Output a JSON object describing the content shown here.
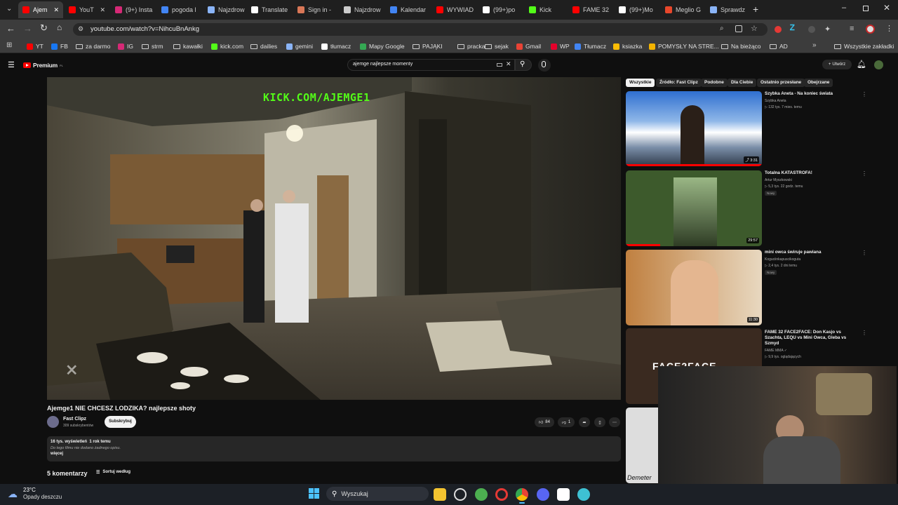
{
  "browser": {
    "tabs": [
      {
        "label": "Ajem",
        "color": "#ff0000",
        "active": true
      },
      {
        "label": "YouT",
        "color": "#ff0000"
      },
      {
        "label": "(9+) Insta",
        "color": "#d62976"
      },
      {
        "label": "pogoda l",
        "color": "#4285f4"
      },
      {
        "label": "Najzdrow",
        "color": "#8ab4f8"
      },
      {
        "label": "Translate",
        "color": "#ffffff"
      },
      {
        "label": "Sign in -",
        "color": "#d97757"
      },
      {
        "label": "Najzdrow",
        "color": "#cccccc"
      },
      {
        "label": "Kalendar",
        "color": "#4285f4"
      },
      {
        "label": "WYWIAD",
        "color": "#ff0000"
      },
      {
        "label": "(99+)po",
        "color": "#ffffff"
      },
      {
        "label": "Kick",
        "color": "#53fc18"
      },
      {
        "label": "FAME 32",
        "color": "#ff0000"
      },
      {
        "label": "(99+)Mo",
        "color": "#ffffff"
      },
      {
        "label": "Meglio G",
        "color": "#e8472b"
      },
      {
        "label": "Sprawdz",
        "color": "#8ab4f8"
      }
    ],
    "new_tab_label": "+",
    "url": "youtube.com/watch?v=NihcuBnAnkg",
    "bookmarks": [
      {
        "label": "YT",
        "color": "#ff0000"
      },
      {
        "label": "FB",
        "color": "#1877f2"
      },
      {
        "label": "za darmo",
        "color": "folder"
      },
      {
        "label": "IG",
        "color": "#d62976"
      },
      {
        "label": "strm",
        "color": "folder"
      },
      {
        "label": "kawałki",
        "color": "folder"
      },
      {
        "label": "kick.com",
        "color": "#53fc18"
      },
      {
        "label": "dailies",
        "color": "folder"
      },
      {
        "label": "gemini",
        "color": "#8ab4f8"
      },
      {
        "label": "tłumacz",
        "color": "#ffffff"
      },
      {
        "label": "Mapy Google",
        "color": "#34a853"
      },
      {
        "label": "PAJĄKI",
        "color": "folder"
      },
      {
        "label": "pracka",
        "color": "folder"
      },
      {
        "label": "sejak",
        "color": "folder"
      },
      {
        "label": "Gmail",
        "color": "#ea4335"
      },
      {
        "label": "WP",
        "color": "#e4002b"
      },
      {
        "label": "Tłumacz",
        "color": "#4285f4"
      },
      {
        "label": "ksiazka",
        "color": "#fbbc05"
      },
      {
        "label": "POMYSŁY NA STRE...",
        "color": "#f4b400"
      },
      {
        "label": "Na bieżąco",
        "color": "folder"
      },
      {
        "label": "AD",
        "color": "folder"
      }
    ],
    "all_bookmarks_label": "Wszystkie zakładki"
  },
  "youtube": {
    "logo_label": "Premium",
    "logo_suffix": "PL",
    "search_value": "ajemge najlepsze momenty",
    "create_label": "Utwórz",
    "video_overlay": "KICK.COM/AJEMGE1",
    "video_title": "Ajemge1 NIE CHCESZ LODZIKA? najlepsze shoty",
    "channel_name": "Fast Clipz",
    "subscribers": "309 subskrybentów",
    "subscribe_label": "Subskrybuj",
    "likes": "84",
    "dislikes": "1",
    "views_line": "16 tys. wyświetleń  1 rok temu",
    "description": "Do tego filmu nie dodano żadnego opisu.",
    "more_label": "więcej",
    "comments_count": "5 komentarzy",
    "sort_label": "Sortuj według",
    "chips": [
      "Wszystkie",
      "Źródło: Fast Clipz",
      "Podobne",
      "Dla Ciebie",
      "Ostatnio przesłane",
      "Obejrzane"
    ],
    "recommendations": [
      {
        "title": "Szybka Aneta - Na koniec świata",
        "channel": "Szybka Aneta",
        "meta": "▷ 132 tys.  7 mies. temu",
        "duration": "⤴ 3:31",
        "badge": ""
      },
      {
        "title": "Totalna KATASTROFA!",
        "channel": "Artur Myszkowski",
        "meta": "▷ 5,3 tys.  22 godz. temu",
        "duration": "29:57",
        "badge": "Nowy"
      },
      {
        "title": "mini owca świruje pawiana",
        "channel": "Koguciinkapuscikoguta",
        "meta": "▷ 2,4 tys.  2 dni temu",
        "duration": "11:30",
        "badge": "Nowy"
      },
      {
        "title": "FAME 32 FACE2FACE: Don Kasjo vs Szachta, LEQU vs Mini Owca, Gleba vs Szmyd",
        "channel": "FAME MMA ✓",
        "meta": "▷ 9,9 tys. oglądających",
        "duration": "",
        "badge": ""
      }
    ],
    "thumb_overlay_text": "FACE2FACE",
    "thumb_overlay_text2": "Demeter"
  },
  "taskbar": {
    "weather_temp": "23°C",
    "weather_desc": "Opady deszczu",
    "search_label": "Wyszukaj"
  },
  "colors": {
    "kick_green": "#53fc18",
    "yt_red": "#ff0000",
    "accent_blue": "#3ea6ff"
  }
}
